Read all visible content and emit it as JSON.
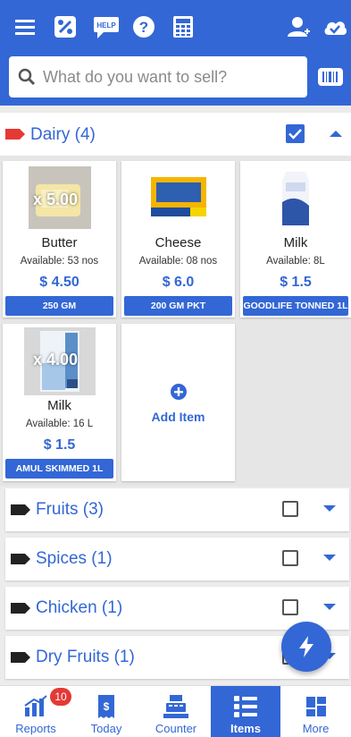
{
  "search": {
    "placeholder": "What do you want to sell?"
  },
  "toolbar": {
    "icons": [
      "menu-icon",
      "discount-icon",
      "help-chat-icon",
      "help-icon",
      "calculator-icon",
      "add-user-icon",
      "cloud-sync-icon"
    ],
    "help_chat_label": "HELP"
  },
  "category": {
    "title": "Dairy (4)",
    "checked": true,
    "tag_color": "#e53935",
    "items": [
      {
        "name": "Butter",
        "available": "Available: 53 nos",
        "price": "$ 4.50",
        "variant": "250 GM",
        "qty": "x 5.00"
      },
      {
        "name": "Cheese",
        "available": "Available: 08 nos",
        "price": "$ 6.0",
        "variant": "200 GM PKT",
        "qty": ""
      },
      {
        "name": "Milk",
        "available": "Available: 8L",
        "price": "$ 1.5",
        "variant": "GOODLIFE TONNED 1L",
        "qty": ""
      },
      {
        "name": "Milk",
        "available": "Available: 16 L",
        "price": "$ 1.5",
        "variant": "AMUL SKIMMED 1L",
        "qty": "x 4.00"
      }
    ],
    "add_item_label": "Add Item"
  },
  "other_categories": [
    {
      "title": "Fruits (3)"
    },
    {
      "title": "Spices (1)"
    },
    {
      "title": "Chicken (1)"
    },
    {
      "title": "Dry Fruits (1)"
    }
  ],
  "bottom_nav": [
    {
      "label": "Reports",
      "badge": "10"
    },
    {
      "label": "Today"
    },
    {
      "label": "Counter"
    },
    {
      "label": "Items",
      "active": true
    },
    {
      "label": "More"
    }
  ],
  "colors": {
    "primary": "#3367d6",
    "badge": "#e53935"
  }
}
